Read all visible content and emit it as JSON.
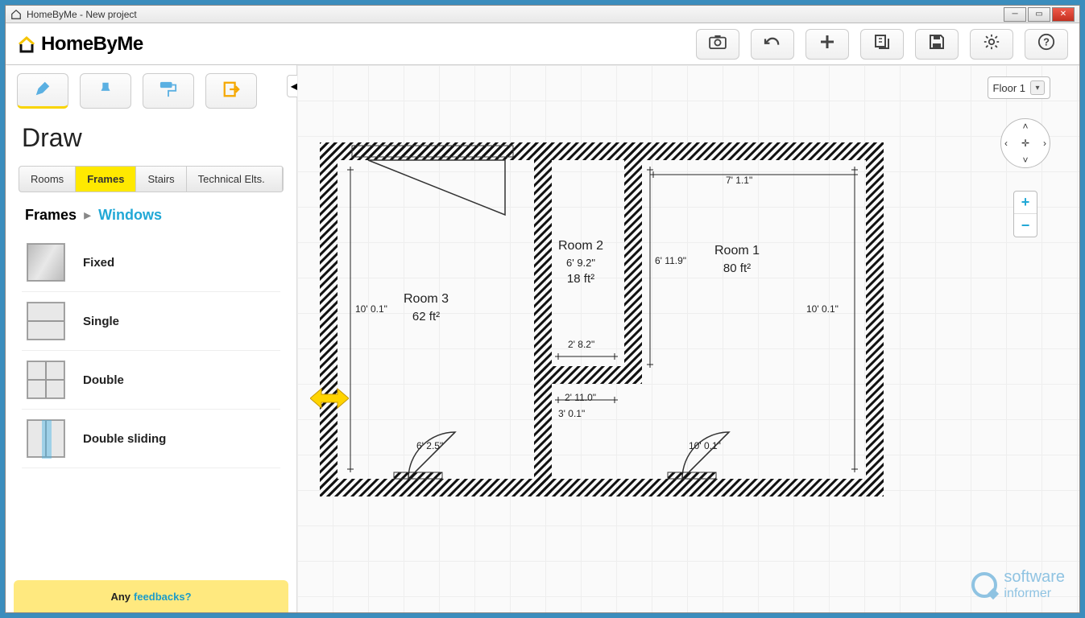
{
  "window": {
    "title": "HomeByMe - New project"
  },
  "app": {
    "name": "HomeByMe"
  },
  "toolbar_buttons": [
    "photo",
    "undo",
    "add",
    "copy",
    "save",
    "settings",
    "help"
  ],
  "sidebar": {
    "section": "Draw",
    "subtabs": [
      {
        "label": "Rooms",
        "active": false
      },
      {
        "label": "Frames",
        "active": true
      },
      {
        "label": "Stairs",
        "active": false
      },
      {
        "label": "Technical Elts.",
        "active": false
      }
    ],
    "breadcrumb": {
      "cat1": "Frames",
      "cat2": "Windows"
    },
    "items": [
      {
        "label": "Fixed",
        "thumb": "fixed"
      },
      {
        "label": "Single",
        "thumb": "single"
      },
      {
        "label": "Double",
        "thumb": "double"
      },
      {
        "label": "Double sliding",
        "thumb": "dslide"
      }
    ],
    "feedback": {
      "prefix": "Any",
      "link": "feedbacks?"
    }
  },
  "canvas": {
    "floor_label": "Floor 1",
    "rooms": [
      {
        "name": "Room 1",
        "area": "80 ft²"
      },
      {
        "name": "Room 2",
        "dim": "6' 9.2\"",
        "area": "18 ft²"
      },
      {
        "name": "Room 3",
        "area": "62 ft²"
      }
    ],
    "dimensions": {
      "r3_height": "10' 0.1\"",
      "r1_width": "7' 1.1\"",
      "r1_left_h": "6' 11.9\"",
      "r1_right_h": "10' 0.1\"",
      "r2_bottom": "2' 8.2\"",
      "gap_w": "2' 11.0\"",
      "gap_h": "3' 0.1\"",
      "door_l": "6' 2.5\"",
      "door_r": "10' 0.1\""
    }
  },
  "watermark": {
    "line1": "software",
    "line2": "informer"
  }
}
